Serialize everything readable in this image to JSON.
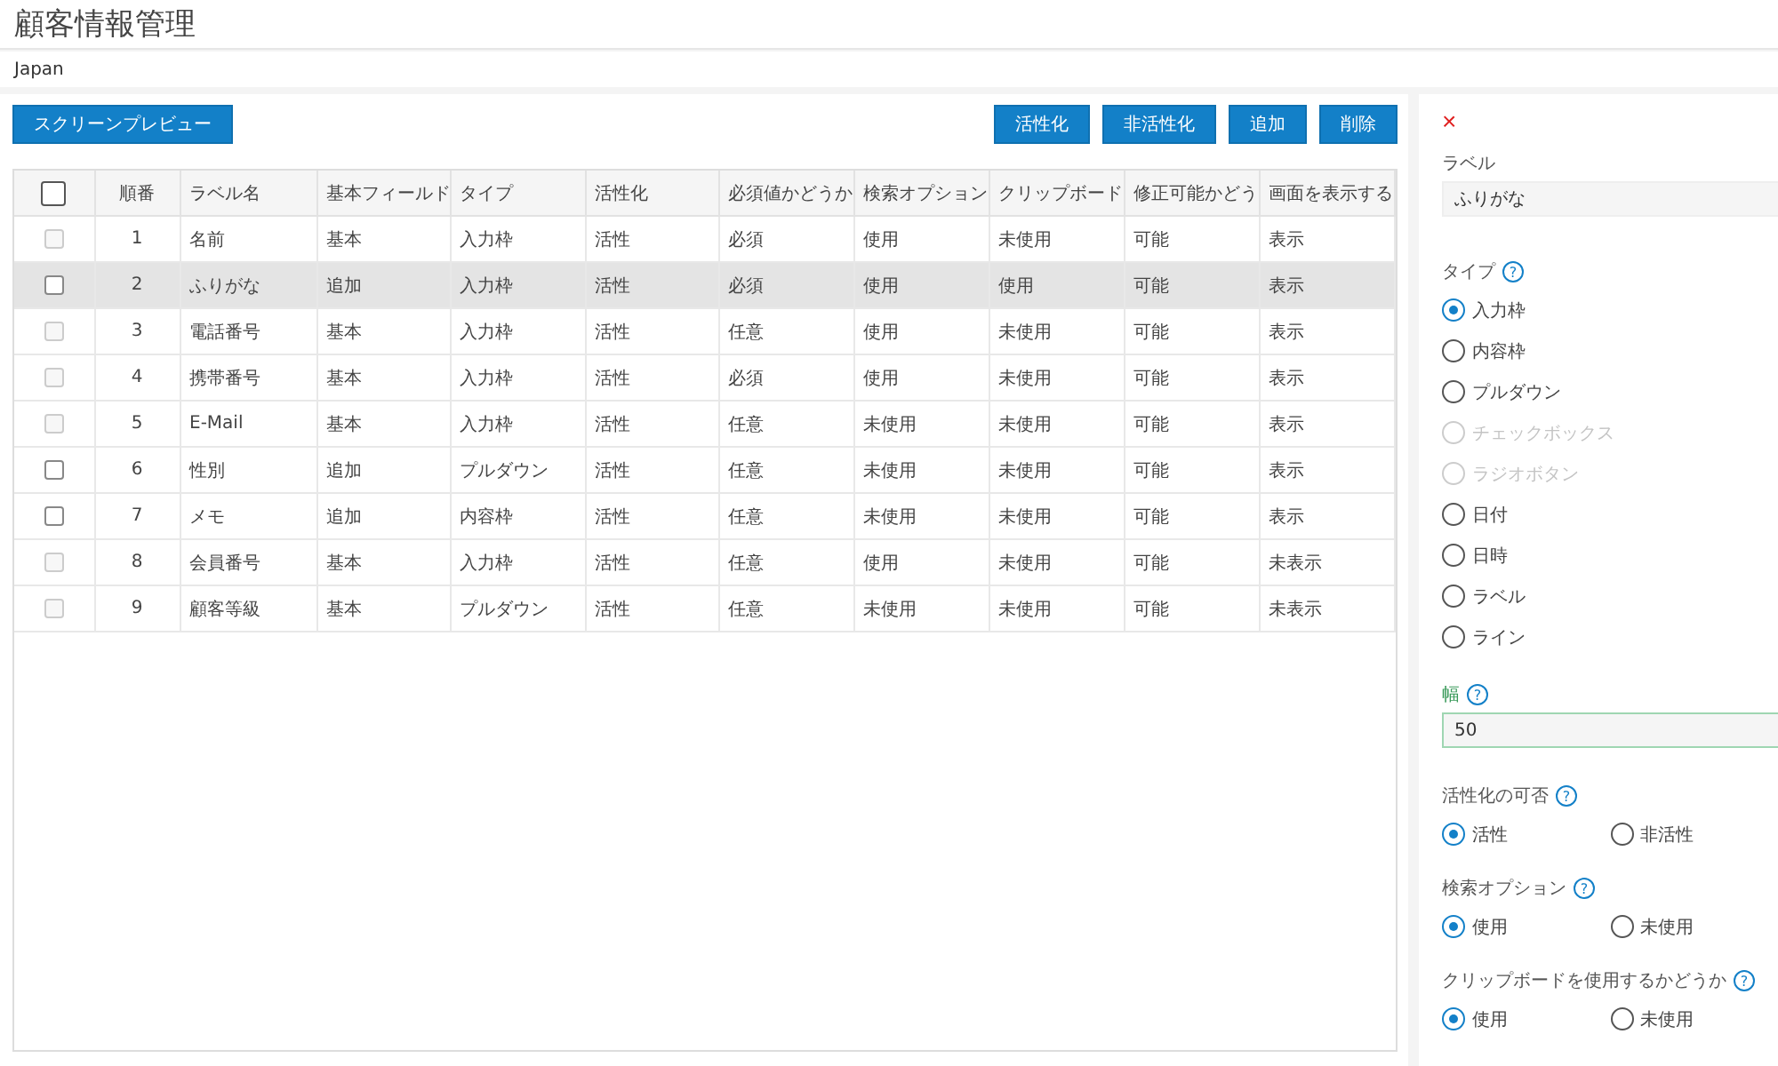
{
  "title": "顧客情報管理",
  "breadcrumb": "Japan",
  "preview_button": "スクリーンプレビュー",
  "actions": [
    "活性化",
    "非活性化",
    "追加",
    "削除"
  ],
  "table": {
    "header_checked": false,
    "columns": [
      "順番",
      "ラベル名",
      "基本フィールド",
      "タイプ",
      "活性化",
      "必須値かどうか",
      "検索オプション",
      "クリップボード",
      "修正可能かどう",
      "画面を表示する"
    ],
    "rows": [
      {
        "checked": false,
        "disabled": true,
        "selected": false,
        "cells": [
          "1",
          "名前",
          "基本",
          "入力枠",
          "活性",
          "必須",
          "使用",
          "未使用",
          "可能",
          "表示"
        ]
      },
      {
        "checked": false,
        "disabled": false,
        "selected": true,
        "cells": [
          "2",
          "ふりがな",
          "追加",
          "入力枠",
          "活性",
          "必須",
          "使用",
          "使用",
          "可能",
          "表示"
        ]
      },
      {
        "checked": false,
        "disabled": true,
        "selected": false,
        "cells": [
          "3",
          "電話番号",
          "基本",
          "入力枠",
          "活性",
          "任意",
          "使用",
          "未使用",
          "可能",
          "表示"
        ]
      },
      {
        "checked": false,
        "disabled": true,
        "selected": false,
        "cells": [
          "4",
          "携帯番号",
          "基本",
          "入力枠",
          "活性",
          "必須",
          "使用",
          "未使用",
          "可能",
          "表示"
        ]
      },
      {
        "checked": false,
        "disabled": true,
        "selected": false,
        "cells": [
          "5",
          "E-Mail",
          "基本",
          "入力枠",
          "活性",
          "任意",
          "未使用",
          "未使用",
          "可能",
          "表示"
        ]
      },
      {
        "checked": false,
        "disabled": false,
        "selected": false,
        "cells": [
          "6",
          "性別",
          "追加",
          "プルダウン",
          "活性",
          "任意",
          "未使用",
          "未使用",
          "可能",
          "表示"
        ]
      },
      {
        "checked": false,
        "disabled": false,
        "selected": false,
        "cells": [
          "7",
          "メモ",
          "追加",
          "内容枠",
          "活性",
          "任意",
          "未使用",
          "未使用",
          "可能",
          "表示"
        ]
      },
      {
        "checked": false,
        "disabled": true,
        "selected": false,
        "cells": [
          "8",
          "会員番号",
          "基本",
          "入力枠",
          "活性",
          "任意",
          "使用",
          "未使用",
          "可能",
          "未表示"
        ]
      },
      {
        "checked": false,
        "disabled": true,
        "selected": false,
        "cells": [
          "9",
          "顧客等級",
          "基本",
          "プルダウン",
          "活性",
          "任意",
          "未使用",
          "未使用",
          "可能",
          "未表示"
        ]
      }
    ]
  },
  "panel": {
    "close": "×",
    "label": {
      "title": "ラベル",
      "value": "ふりがな"
    },
    "type": {
      "title": "タイプ",
      "help": "?",
      "options": [
        {
          "label": "入力枠",
          "selected": true,
          "disabled": false
        },
        {
          "label": "内容枠",
          "selected": false,
          "disabled": false
        },
        {
          "label": "プルダウン",
          "selected": false,
          "disabled": false
        },
        {
          "label": "チェックボックス",
          "selected": false,
          "disabled": true
        },
        {
          "label": "ラジオボタン",
          "selected": false,
          "disabled": true
        },
        {
          "label": "日付",
          "selected": false,
          "disabled": false
        },
        {
          "label": "日時",
          "selected": false,
          "disabled": false
        },
        {
          "label": "ラベル",
          "selected": false,
          "disabled": false
        },
        {
          "label": "ライン",
          "selected": false,
          "disabled": false
        }
      ]
    },
    "width": {
      "title": "幅",
      "help": "?",
      "value": "50"
    },
    "groups": [
      {
        "title": "活性化の可否",
        "help": "?",
        "options": [
          {
            "label": "活性",
            "selected": true
          },
          {
            "label": "非活性",
            "selected": false
          }
        ]
      },
      {
        "title": "検索オプション",
        "help": "?",
        "options": [
          {
            "label": "使用",
            "selected": true
          },
          {
            "label": "未使用",
            "selected": false
          }
        ]
      },
      {
        "title": "クリップボードを使用するかどうか",
        "help": "?",
        "options": [
          {
            "label": "使用",
            "selected": true
          },
          {
            "label": "未使用",
            "selected": false
          }
        ]
      }
    ]
  }
}
